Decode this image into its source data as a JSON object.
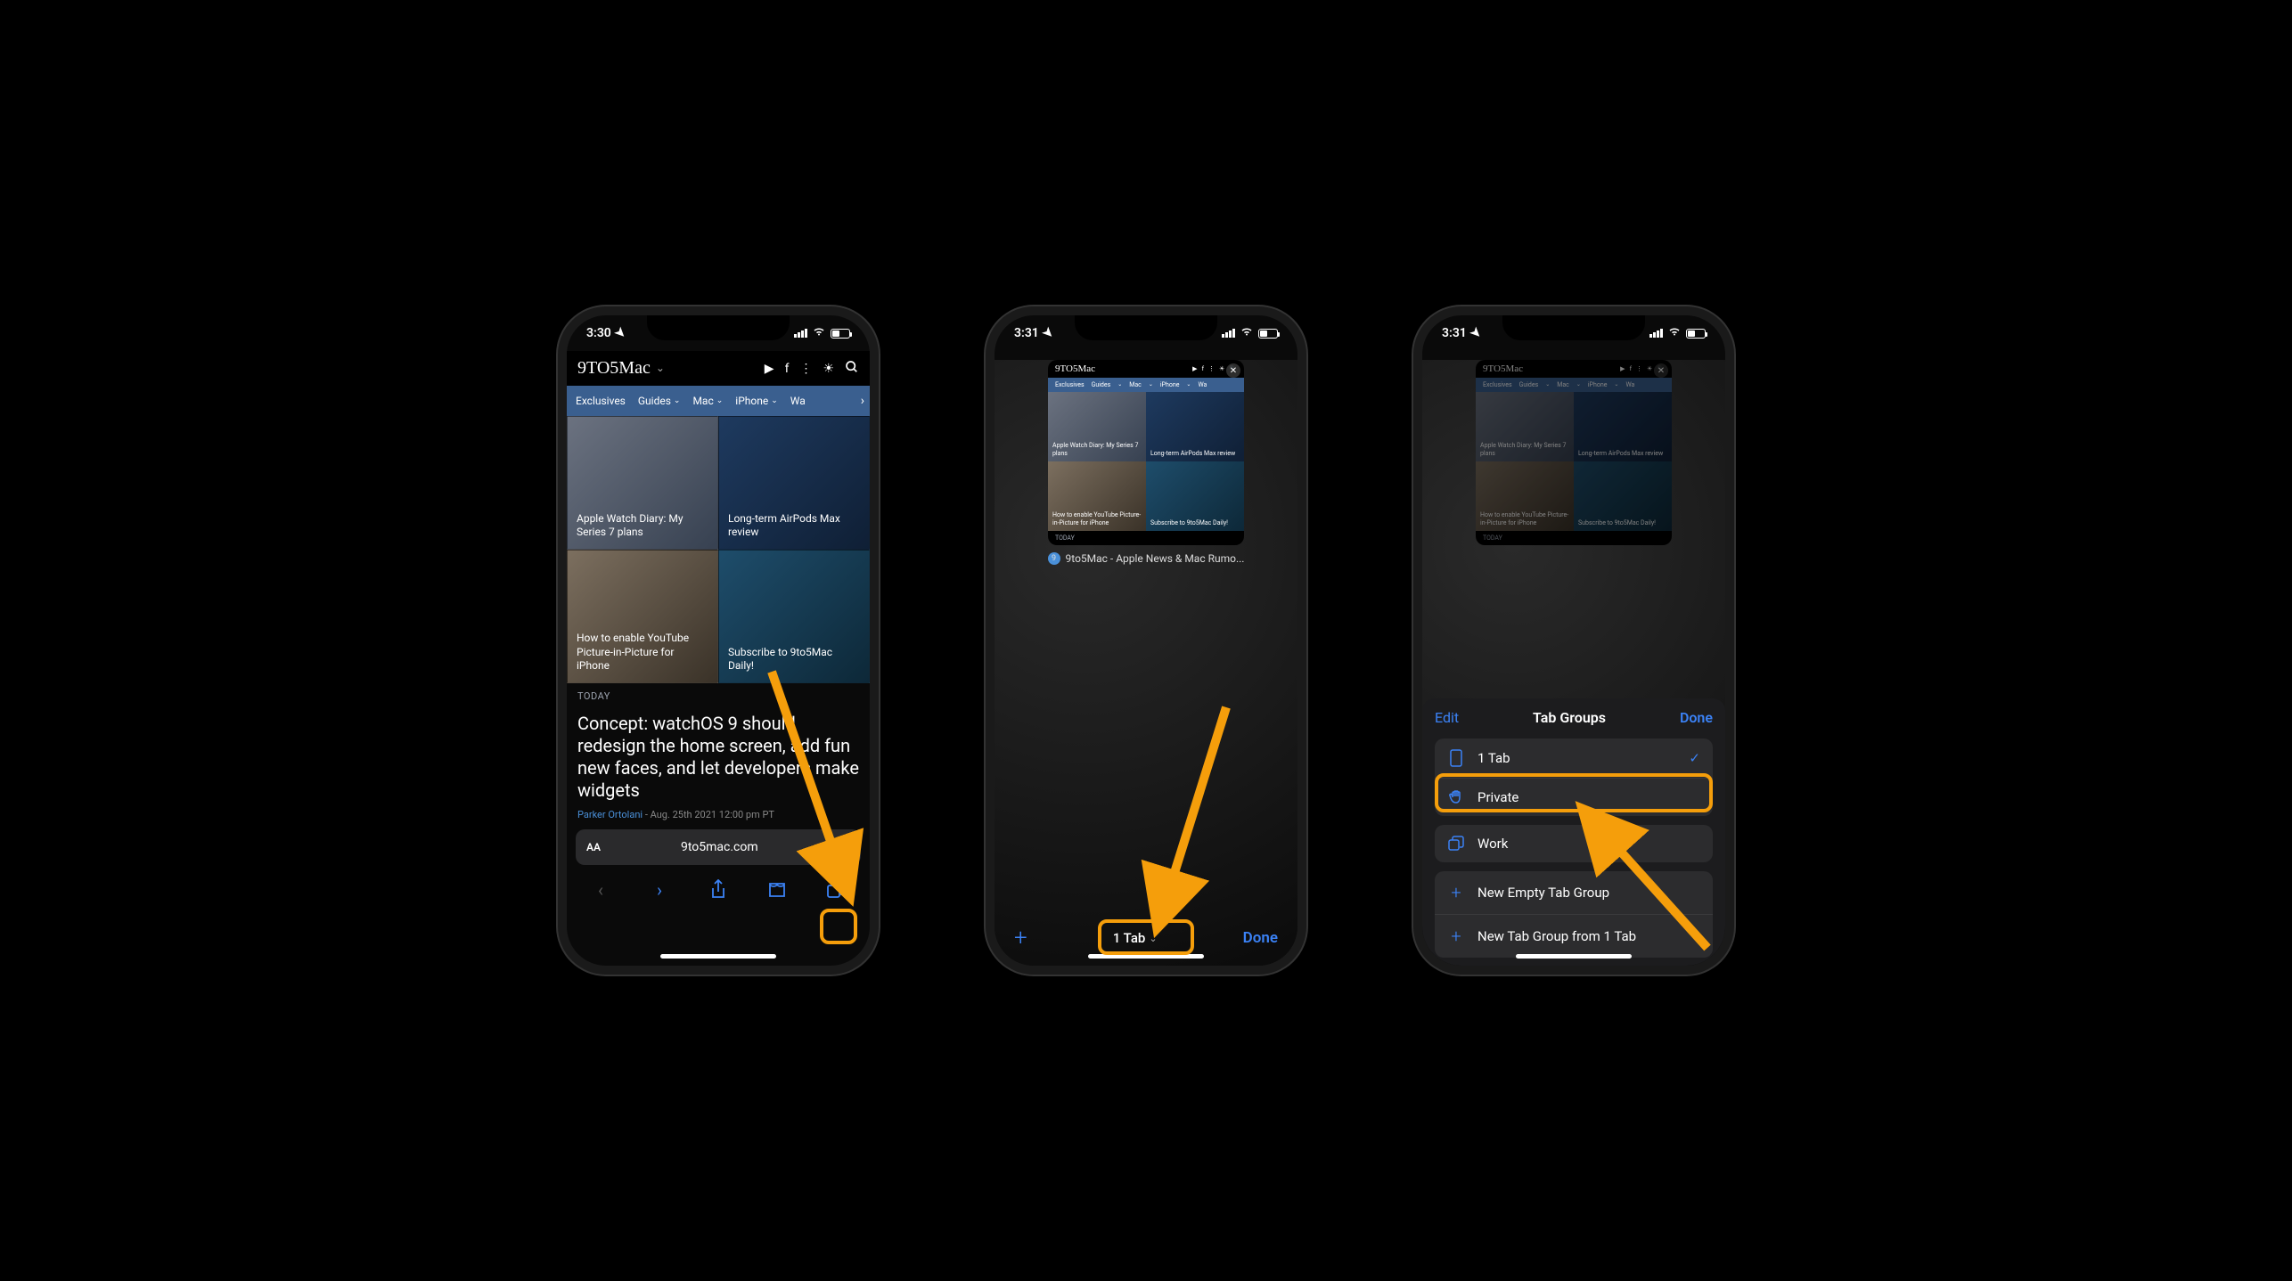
{
  "status": {
    "time1": "3:30",
    "time2": "3:31",
    "time3": "3:31"
  },
  "site": {
    "logo": "9TO5Mac",
    "nav": [
      "Exclusives",
      "Guides",
      "Mac",
      "iPhone",
      "Wa"
    ],
    "tiles": [
      "Apple Watch Diary: My Series 7 plans",
      "Long-term AirPods Max review",
      "How to enable YouTube Picture-in-Picture for iPhone",
      "Subscribe to 9to5Mac Daily!"
    ],
    "today": "TODAY",
    "headline": "Concept: watchOS 9 should redesign the home screen, add fun new faces, and let developers make widgets",
    "author": "Parker Ortolani",
    "date": "- Aug. 25th 2021 12:00 pm PT",
    "domain": "9to5mac.com",
    "aa": "AA"
  },
  "tabview": {
    "tab_title": "9to5Mac - Apple News & Mac Rumo...",
    "count_label": "1 Tab",
    "done": "Done",
    "thumb_nav": [
      "Exclusives",
      "Guides",
      "Mac",
      "iPhone",
      "Wa"
    ]
  },
  "sheet": {
    "edit": "Edit",
    "title": "Tab Groups",
    "done": "Done",
    "item_1tab": "1 Tab",
    "item_private": "Private",
    "item_work": "Work",
    "new_empty": "New Empty Tab Group",
    "new_from": "New Tab Group from 1 Tab"
  }
}
